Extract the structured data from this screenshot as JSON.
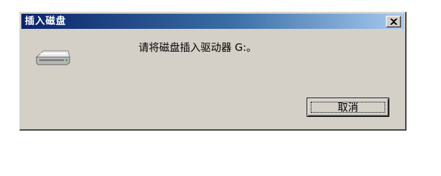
{
  "dialog": {
    "title": "插入磁盘",
    "message": "请将磁盘插入驱动器 G:。",
    "cancel_label": "取消",
    "close_icon": "close-icon",
    "drive_icon": "removable-drive-icon"
  },
  "colors": {
    "titlebar_start": "#0a246a",
    "titlebar_end": "#a6caf0",
    "face": "#d4d0c8"
  }
}
